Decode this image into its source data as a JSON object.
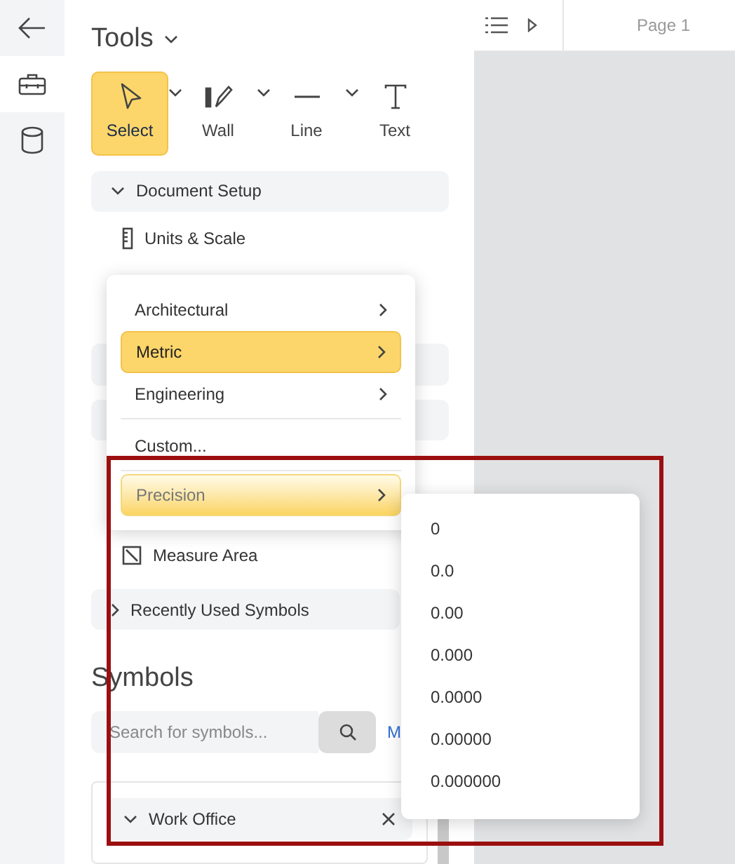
{
  "rail": [
    {
      "selected": false
    },
    {
      "selected": true
    },
    {
      "selected": false
    }
  ],
  "tools": {
    "title": "Tools",
    "items": [
      {
        "label": "Select",
        "selected": true,
        "has_menu": true
      },
      {
        "label": "Wall",
        "selected": false,
        "has_menu": true
      },
      {
        "label": "Line",
        "selected": false,
        "has_menu": true
      },
      {
        "label": "Text",
        "selected": false,
        "has_menu": false
      }
    ]
  },
  "document_setup": {
    "label": "Document Setup",
    "expanded": true,
    "items": [
      {
        "label": "Units & Scale"
      }
    ]
  },
  "measure_items": [
    {
      "label": "Measure Area"
    }
  ],
  "recently_used": {
    "label": "Recently Used Symbols",
    "expanded": false
  },
  "symbols": {
    "title": "Symbols",
    "search_placeholder": "Search for symbols...",
    "link": "M",
    "group": {
      "label": "Work Office",
      "expanded": true
    }
  },
  "toolbar": {
    "page": "Page 1"
  },
  "menu": [
    {
      "kind": "item",
      "label": "Architectural",
      "submenu": true,
      "selected": false,
      "hovered": false
    },
    {
      "kind": "item",
      "label": "Metric",
      "submenu": true,
      "selected": true,
      "hovered": false
    },
    {
      "kind": "item",
      "label": "Engineering",
      "submenu": true,
      "selected": false,
      "hovered": false
    },
    {
      "kind": "divider"
    },
    {
      "kind": "item",
      "label": "Custom...",
      "submenu": false,
      "selected": false,
      "hovered": false
    },
    {
      "kind": "divider"
    },
    {
      "kind": "item",
      "label": "Precision",
      "submenu": true,
      "selected": false,
      "hovered": true
    }
  ],
  "submenu": [
    "0",
    "0.0",
    "0.00",
    "0.000",
    "0.0000",
    "0.00000",
    "0.000000"
  ]
}
